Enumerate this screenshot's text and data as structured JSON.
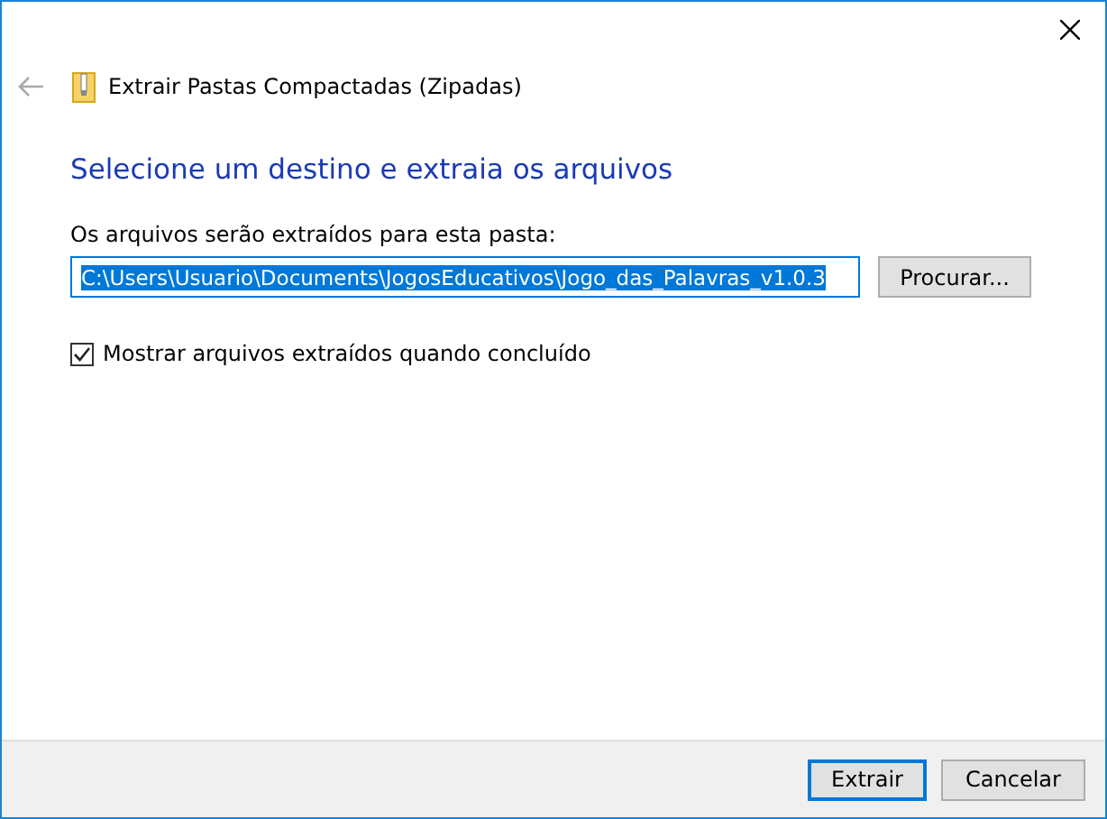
{
  "window": {
    "title": "Extrair Pastas Compactadas (Zipadas)"
  },
  "heading": "Selecione um destino e extraia os arquivos",
  "destination": {
    "label": "Os arquivos serão extraídos para esta pasta:",
    "value": "C:\\Users\\Usuario\\Documents\\JogosEducativos\\Jogo_das_Palavras_v1.0.3",
    "text_selected": true,
    "browse_button": "Procurar..."
  },
  "show_files": {
    "label": "Mostrar arquivos extraídos quando concluído",
    "checked": true
  },
  "buttons": [
    {
      "label": "Extrair",
      "default": true
    },
    {
      "label": "Cancelar",
      "default": false
    }
  ]
}
